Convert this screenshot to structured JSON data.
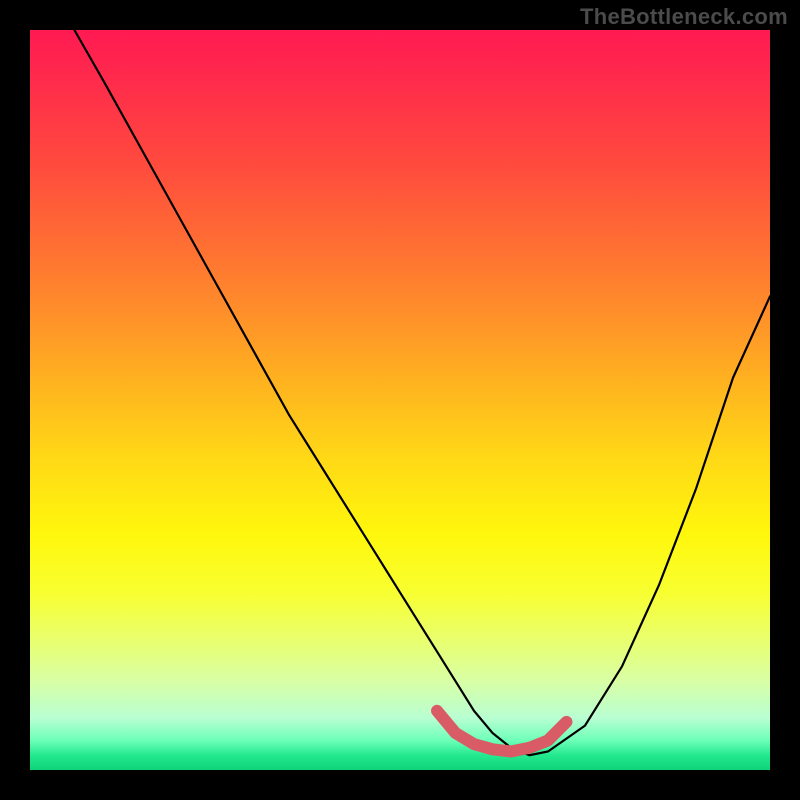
{
  "watermark": "TheBottleneck.com",
  "chart_data": {
    "type": "line",
    "title": "",
    "xlabel": "",
    "ylabel": "",
    "xlim": [
      0,
      100
    ],
    "ylim": [
      0,
      100
    ],
    "grid": false,
    "legend": false,
    "series": [
      {
        "name": "curve",
        "color": "#000000",
        "x": [
          6,
          10,
          15,
          20,
          25,
          30,
          35,
          40,
          45,
          50,
          55,
          57.5,
          60,
          62.5,
          65,
          67.5,
          70,
          75,
          80,
          85,
          90,
          95,
          100
        ],
        "values": [
          100,
          93,
          84,
          75,
          66,
          57,
          48,
          40,
          32,
          24,
          16,
          12,
          8,
          5,
          3,
          2,
          2.5,
          6,
          14,
          25,
          38,
          53,
          64
        ]
      },
      {
        "name": "highlight",
        "color": "#d95b66",
        "x": [
          55,
          57.5,
          60,
          62.5,
          65,
          67.5,
          70,
          72.5
        ],
        "values": [
          8,
          5,
          3.5,
          2.8,
          2.5,
          3,
          4,
          6.5
        ]
      }
    ],
    "gradient_stops": [
      {
        "pos": 0,
        "color": "#ff1a52"
      },
      {
        "pos": 18,
        "color": "#ff4a3e"
      },
      {
        "pos": 38,
        "color": "#ff8e2a"
      },
      {
        "pos": 58,
        "color": "#ffd916"
      },
      {
        "pos": 76,
        "color": "#f8ff30"
      },
      {
        "pos": 93,
        "color": "#b8ffd2"
      },
      {
        "pos": 100,
        "color": "#0ed37a"
      }
    ]
  }
}
